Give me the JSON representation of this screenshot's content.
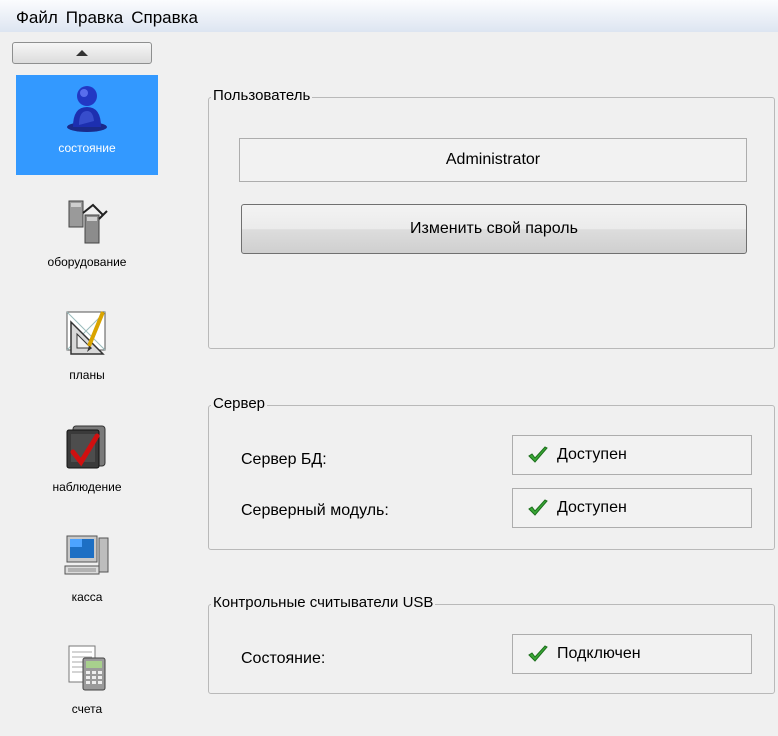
{
  "menu": [
    "Файл",
    "Правка",
    "Справка"
  ],
  "sidebar": {
    "items": [
      {
        "label": "состояние",
        "icon": "user-status-icon"
      },
      {
        "label": "оборудование",
        "icon": "hardware-icon"
      },
      {
        "label": "планы",
        "icon": "plans-icon"
      },
      {
        "label": "наблюдение",
        "icon": "monitoring-icon"
      },
      {
        "label": "касса",
        "icon": "cashier-computer-icon"
      },
      {
        "label": "счета",
        "icon": "accounts-calculator-icon"
      }
    ],
    "active_index": 0
  },
  "user_group": {
    "title": "Пользователь",
    "username": "Administrator",
    "change_password_label": "Изменить свой пароль"
  },
  "server_group": {
    "title": "Сервер",
    "rows": [
      {
        "label": "Сервер БД:",
        "status": "Доступен"
      },
      {
        "label": "Серверный модуль:",
        "status": "Доступен"
      }
    ]
  },
  "usb_group": {
    "title": "Контрольные считыватели USB",
    "rows": [
      {
        "label": "Состояние:",
        "status": "Подключен"
      }
    ]
  },
  "colors": {
    "active_item_bg": "#3399ff",
    "check_green": "#3aa836"
  }
}
